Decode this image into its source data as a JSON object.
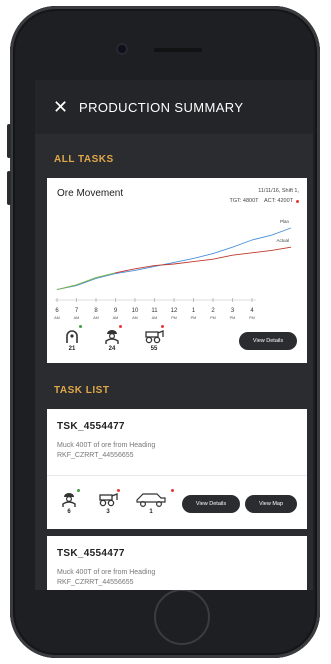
{
  "header": {
    "title": "PRODUCTION SUMMARY"
  },
  "all_tasks": {
    "section_title": "ALL TASKS",
    "card": {
      "title": "Ore Movement",
      "date_shift": "11/11/16, Shift 1,",
      "target": "TGT: 4800T",
      "actual": "ACT: 4200T",
      "stats": [
        {
          "icon": "miner-icon",
          "value": "21",
          "status_color": "#43a047"
        },
        {
          "icon": "worker-icon",
          "value": "24",
          "status_color": "#e53935"
        },
        {
          "icon": "loader-icon",
          "value": "55",
          "status_color": "#e53935"
        }
      ],
      "view_details_label": "View Details"
    },
    "chart_data": {
      "type": "line",
      "x_labels": [
        "6 AM",
        "7 AM",
        "8 AM",
        "9 AM",
        "10 AM",
        "11 AM",
        "12 PM",
        "1 PM",
        "2 PM",
        "3 PM",
        "4 PM"
      ],
      "x_top": [
        "6",
        "7",
        "8",
        "9",
        "10",
        "11",
        "12",
        "1",
        "2",
        "3",
        "4"
      ],
      "x_bottom": [
        "AM",
        "AM",
        "AM",
        "AM",
        "AM",
        "AM",
        "PM",
        "PM",
        "PM",
        "PM",
        "PM"
      ],
      "series": [
        {
          "name": "Plan",
          "color": "#4a90d9",
          "values": [
            3,
            8,
            17,
            23,
            27,
            32,
            37,
            42,
            48,
            56,
            65,
            71,
            80
          ]
        },
        {
          "name": "Actual",
          "color": "#c0392b",
          "values": [
            null,
            null,
            null,
            24,
            29,
            33,
            35,
            38,
            41,
            46,
            49,
            52,
            56
          ]
        },
        {
          "name": "",
          "color": "#7cb342",
          "values": [
            3,
            9,
            18,
            24
          ]
        }
      ],
      "x_positions": [
        0,
        0.5,
        1,
        1.5,
        2,
        2.5,
        3,
        3.5,
        4,
        4.5,
        5,
        5.5,
        6
      ]
    }
  },
  "task_list": {
    "section_title": "TASK LIST",
    "tasks": [
      {
        "id": "TSK_4554477",
        "description": "Muck 400T of ore from Heading",
        "reference": "RKF_CZRRT_44556655",
        "stats": [
          {
            "icon": "worker-icon",
            "value": "6",
            "status_color": "#43a047"
          },
          {
            "icon": "loader-icon",
            "value": "3",
            "status_color": "#e53935"
          },
          {
            "icon": "truck-icon",
            "value": "1",
            "status_color": "#e53935"
          }
        ],
        "view_details_label": "View Details",
        "view_map_label": "View Map"
      },
      {
        "id": "TSK_4554477",
        "description": "Muck 400T of ore from Heading",
        "reference": "RKF_CZRRT_44556655"
      }
    ]
  }
}
